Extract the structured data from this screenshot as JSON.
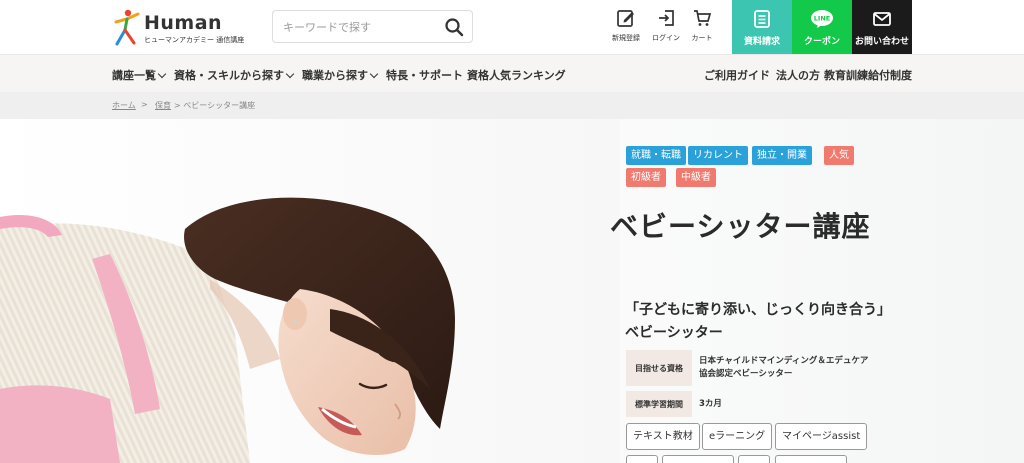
{
  "header": {
    "logo_word": "Human",
    "logo_sub": "ヒューマンアカデミー 通信講座",
    "search_placeholder": "キーワードで探す",
    "icons": [
      {
        "name": "signup",
        "label": "新規登録"
      },
      {
        "name": "login",
        "label": "ログイン"
      },
      {
        "name": "cart",
        "label": "カート"
      }
    ],
    "cta": [
      {
        "name": "brochure",
        "label": "資料請求",
        "color": "#3cc6b2"
      },
      {
        "name": "coupon",
        "label": "クーポン",
        "color": "#12c94a"
      },
      {
        "name": "contact",
        "label": "お問い合わせ",
        "color": "#1b1b1b"
      }
    ],
    "line_badge": "LINE"
  },
  "nav": {
    "left": [
      {
        "label": "講座一覧",
        "dropdown": true
      },
      {
        "label": "資格・スキルから探す",
        "dropdown": true
      },
      {
        "label": "職業から探す",
        "dropdown": true
      },
      {
        "label": "特長・サポート",
        "dropdown": false
      },
      {
        "label": "資格人気ランキング",
        "dropdown": false
      }
    ],
    "right": [
      {
        "label": "ご利用ガイド"
      },
      {
        "label": "法人の方"
      },
      {
        "label": "教育訓練給付制度"
      }
    ]
  },
  "breadcrumb": [
    {
      "label": "ホーム",
      "link": true
    },
    {
      "label": ">",
      "link": false
    },
    {
      "label": "保育",
      "link": true
    },
    {
      "label": "> ベビーシッター講座",
      "link": false
    }
  ],
  "course": {
    "tags_row1": [
      {
        "label": "就職・転職",
        "style": "blue"
      },
      {
        "label": "リカレント",
        "style": "blue"
      },
      {
        "label": "独立・開業",
        "style": "blue"
      },
      {
        "label": "人気",
        "style": "pink"
      }
    ],
    "tags_row2": [
      {
        "label": "初級者",
        "style": "coral"
      },
      {
        "label": "中級者",
        "style": "coral"
      }
    ],
    "title": "ベビーシッター講座",
    "catch_line1": "「子どもに寄り添い、じっくり向き合う」",
    "catch_line2": "ベビーシッター",
    "info": [
      {
        "label": "目指せる資格",
        "value_line1": "日本チャイルドマインディング＆エデュケア",
        "value_line2": "協会認定ベビーシッター"
      },
      {
        "label": "標準学習期間",
        "value_line1": "3カ月",
        "value_line2": ""
      }
    ],
    "features": [
      "テキスト教材",
      "eラーニング",
      "マイページassist"
    ]
  }
}
